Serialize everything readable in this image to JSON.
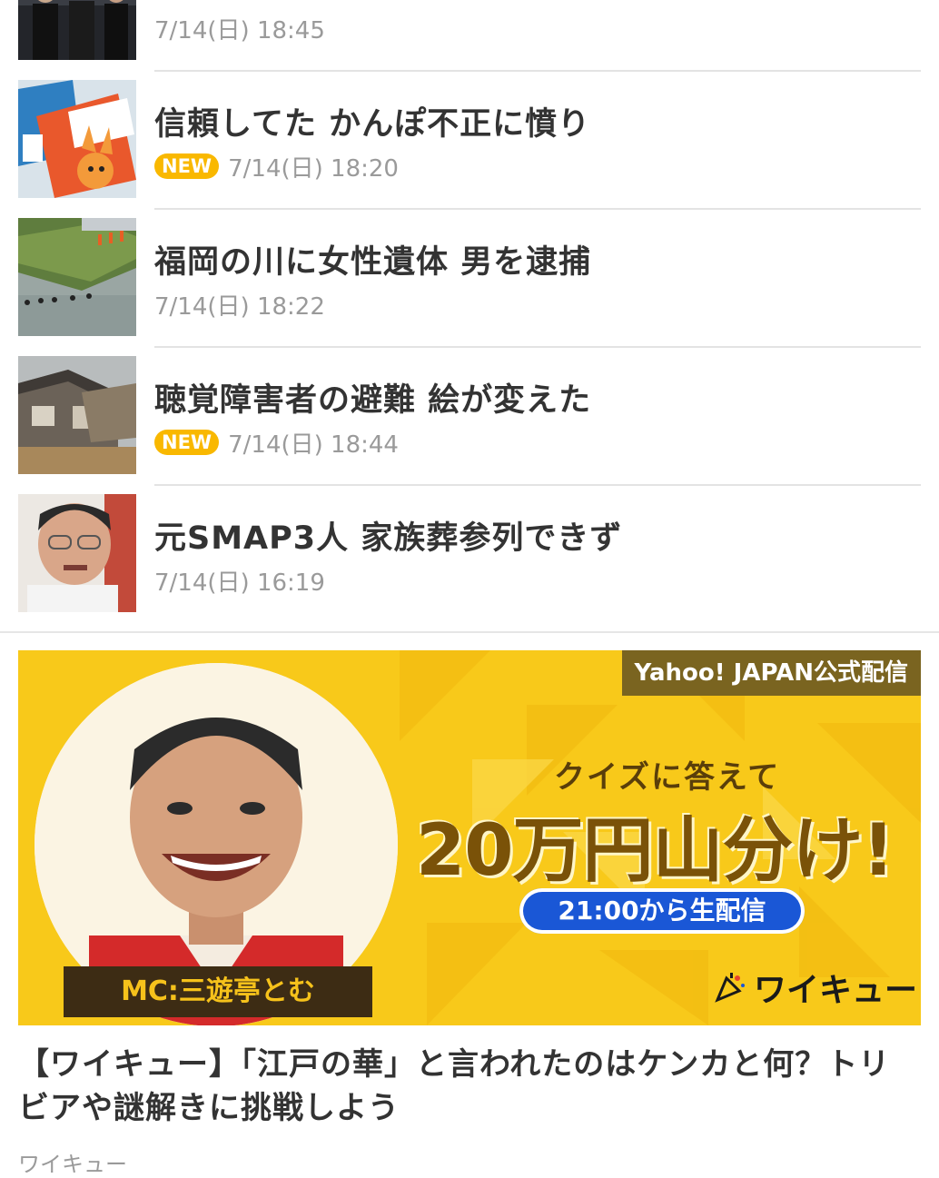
{
  "news": [
    {
      "title": "",
      "new": false,
      "date": "7/14(日) 18:45",
      "thumb_icon": "people-photo"
    },
    {
      "title": "信頼してた かんぽ不正に憤り",
      "new": true,
      "date": "7/14(日) 18:20",
      "thumb_icon": "pamphlet-photo"
    },
    {
      "title": "福岡の川に女性遺体 男を逮捕",
      "new": false,
      "date": "7/14(日) 18:22",
      "thumb_icon": "river-photo"
    },
    {
      "title": "聴覚障害者の避難 絵が変えた",
      "new": true,
      "date": "7/14(日) 18:44",
      "thumb_icon": "flood-house-photo"
    },
    {
      "title": "元SMAP3人 家族葬参列できず",
      "new": false,
      "date": "7/14(日) 16:19",
      "thumb_icon": "man-portrait-photo"
    }
  ],
  "new_badge": "NEW",
  "banner": {
    "official_tag": "Yahoo! JAPAN公式配信",
    "quiz_text": "クイズに答えて",
    "prize_text": "20万円山分け!",
    "live_text": "21:00から生配信",
    "mc_label": "MC:三遊亭とむ",
    "brand": "ワイキュー",
    "colors": {
      "background": "#f8c91a",
      "pill": "#1a57d6",
      "tag": "#7a6420"
    }
  },
  "article": {
    "title": "【ワイキュー】「江戸の華」と言われたのはケンカと何？トリビアや謎解きに挑戦しよう",
    "source": "ワイキュー"
  },
  "colors": {
    "badge": "#f9b800",
    "date": "#9a9a9a",
    "divider": "#e3e3e3"
  }
}
